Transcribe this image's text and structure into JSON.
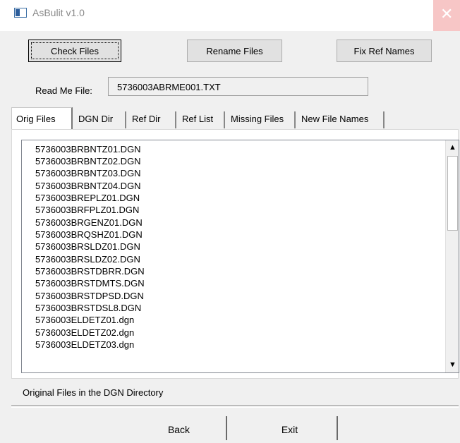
{
  "window": {
    "title": "AsBulit v1.0",
    "close_glyph": "✕"
  },
  "toolbar": {
    "check_files": "Check Files",
    "rename_files": "Rename Files",
    "fix_ref_names": "Fix Ref Names"
  },
  "readme": {
    "label": "Read Me File:",
    "value": "5736003ABRME001.TXT"
  },
  "tabs": [
    "Orig Files",
    "DGN Dir",
    "Ref Dir",
    "Ref List",
    "Missing Files",
    "New File Names"
  ],
  "files": [
    "5736003BRBNTZ01.DGN",
    "5736003BRBNTZ02.DGN",
    "5736003BRBNTZ03.DGN",
    "5736003BRBNTZ04.DGN",
    "5736003BREPLZ01.DGN",
    "5736003BRFPLZ01.DGN",
    "5736003BRGENZ01.DGN",
    "5736003BRQSHZ01.DGN",
    "5736003BRSLDZ01.DGN",
    "5736003BRSLDZ02.DGN",
    "5736003BRSTDBRR.DGN",
    "5736003BRSTDMTS.DGN",
    "5736003BRSTDPSD.DGN",
    "5736003BRSTDSL8.DGN",
    "5736003ELDETZ01.dgn",
    "5736003ELDETZ02.dgn",
    "5736003ELDETZ03.dgn"
  ],
  "status": "Original Files in the DGN Directory",
  "bottom": {
    "back": "Back",
    "exit": "Exit"
  },
  "scrollbar": {
    "up_glyph": "▲",
    "down_glyph": "▼"
  }
}
